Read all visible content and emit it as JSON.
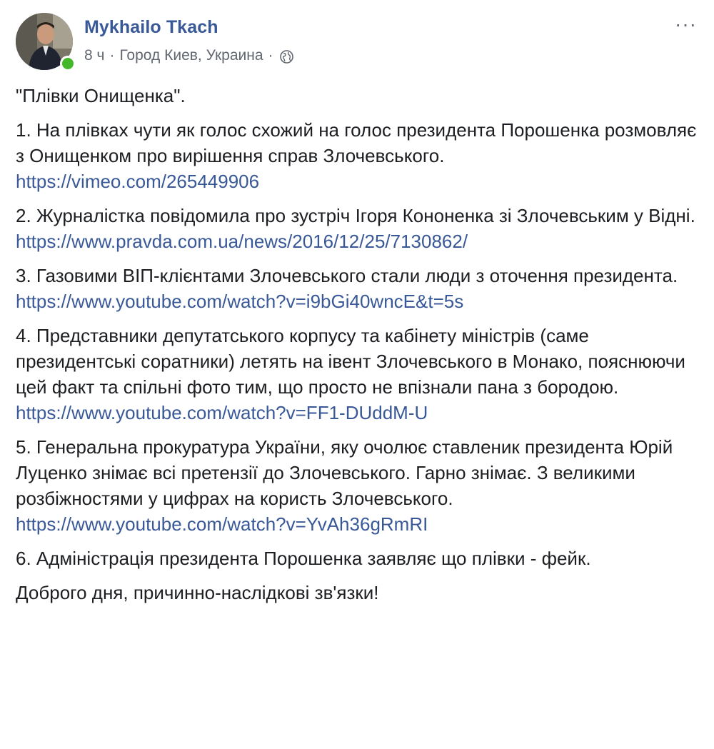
{
  "author": {
    "name": "Mykhailo Tkach",
    "time": "8 ч",
    "location": "Город Киев, Украина",
    "separator": "·",
    "privacy_icon": "globe-icon",
    "online": true,
    "online_color": "#42b72a"
  },
  "menu": {
    "more_label": "···"
  },
  "post": {
    "title": "\"Плівки Онищенка\".",
    "items": [
      {
        "text": "1. На плівках чути як голос схожий на голос президента Порошенка розмовляє з Онищенком про вирішення справ Злочевського.",
        "link": "https://vimeo.com/265449906"
      },
      {
        "text": "2. Журналістка повідомила про зустріч Ігоря Кононенка зі Злочевським у Відні.",
        "link": "https://www.pravda.com.ua/news/2016/12/25/7130862/"
      },
      {
        "text": "3. Газовими ВІП-клієнтами Злочевського стали люди з оточення президента.",
        "link": "https://www.youtube.com/watch?v=i9bGi40wncE&t=5s"
      },
      {
        "text": "4. Представники депутатського корпусу та кабінету міністрів (саме президентські соратники) летять на івент Злочевського в Монако, пояснюючи цей факт та спільні фото тим, що просто не впізнали пана з бородою.",
        "link": "https://www.youtube.com/watch?v=FF1-DUddM-U"
      },
      {
        "text": "5. Генеральна прокуратура України, яку очолює ставленик президента Юрій Луценко знімає всі претензії до Злочевського. Гарно знімає. З великими розбіжностями у цифрах на користь Злочевського.",
        "link": "https://www.youtube.com/watch?v=YvAh36gRmRI"
      },
      {
        "text": "6. Адміністрація президента Порошенка заявляє що плівки - фейк.",
        "link": ""
      }
    ],
    "closing": "Доброго дня, причинно-наслідкові зв'язки!"
  },
  "colors": {
    "link": "#385898",
    "text": "#1c1e21",
    "meta": "#616770"
  }
}
